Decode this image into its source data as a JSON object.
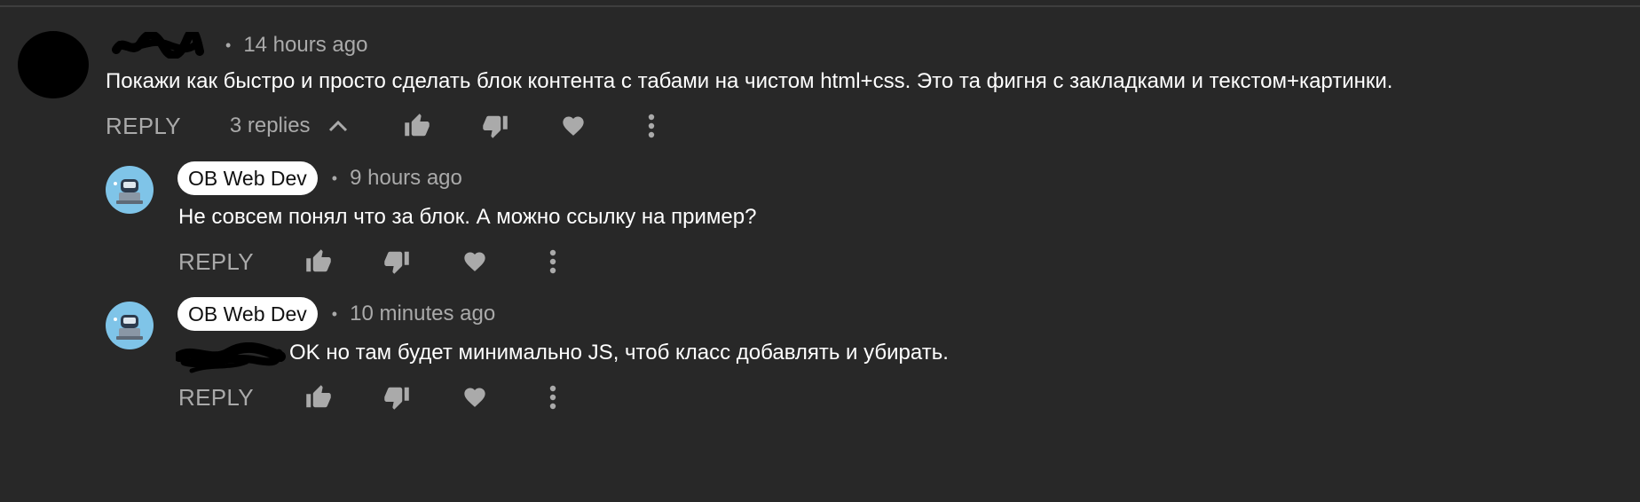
{
  "colors": {
    "background": "#282828",
    "muted": "#aaaaaa",
    "text": "#ffffff",
    "creator_pill": "#ffffff",
    "bot_avatar": "#7fc4e8"
  },
  "main_comment": {
    "time": "14 hours ago",
    "text": "Покажи как быстро и просто сделать блок контента с табами на чистом html+css. Это та фигня с закладками и текстом+картинки.",
    "reply_label": "REPLY",
    "replies_label": "3 replies"
  },
  "replies": [
    {
      "author": "OB Web Dev",
      "time": "9 hours ago",
      "text": "Не совсем понял что за блок. А можно ссылку на пример?",
      "reply_label": "REPLY"
    },
    {
      "author": "OB Web Dev",
      "time": "10 minutes ago",
      "text": "OK но там будет минимально JS, чтоб класс добавлять и убирать.",
      "reply_label": "REPLY"
    }
  ],
  "icons": [
    "like-icon",
    "dislike-icon",
    "heart-icon",
    "more-icon",
    "chevron-up-icon"
  ]
}
